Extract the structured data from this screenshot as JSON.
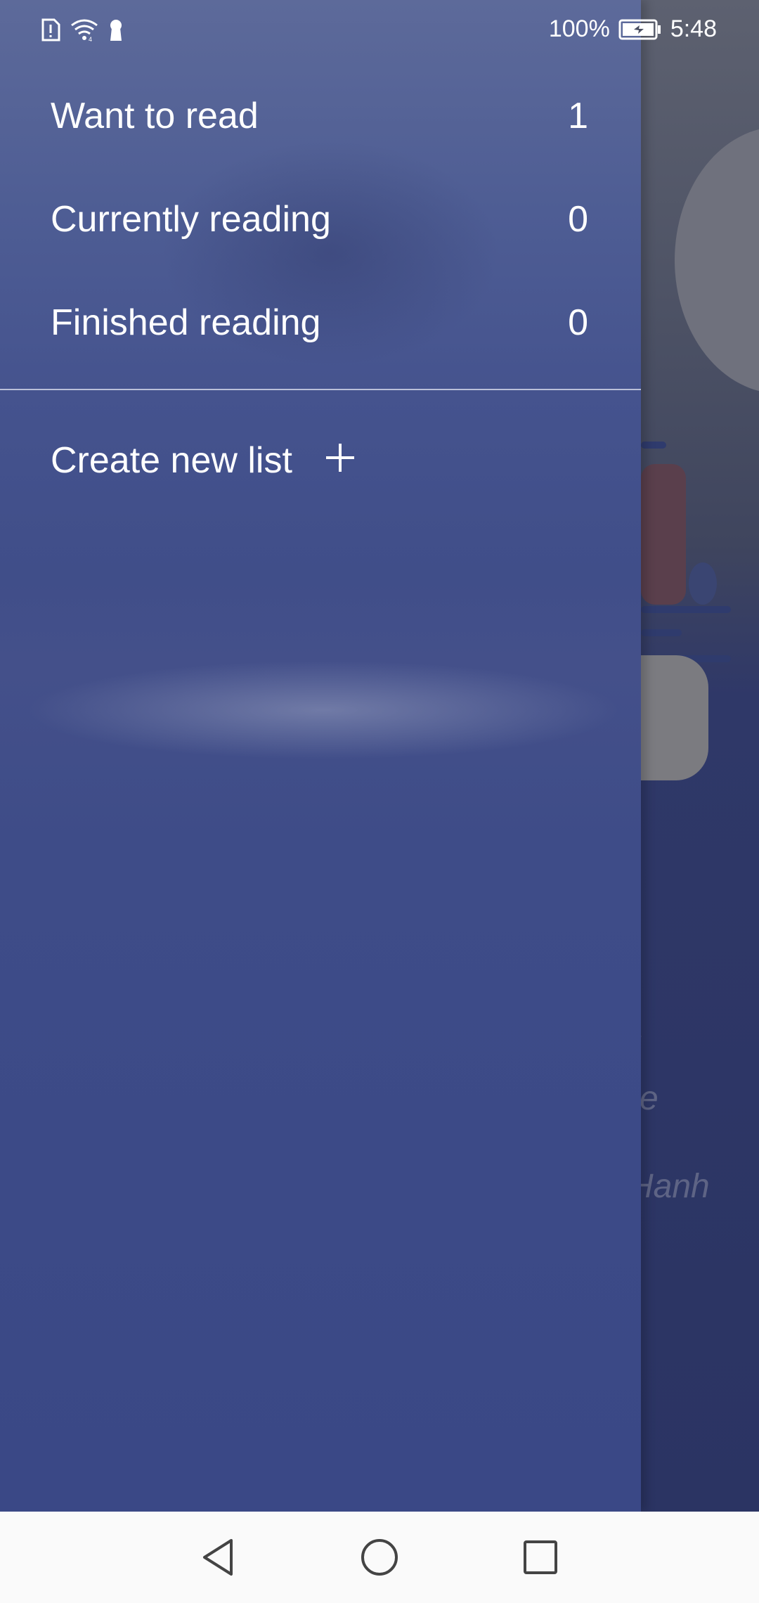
{
  "status_bar": {
    "battery_percent": "100%",
    "time": "5:48",
    "icons": [
      "sim-alert-icon",
      "wifi-icon",
      "keyhole-icon",
      "battery-charging-icon"
    ]
  },
  "drawer": {
    "lists": [
      {
        "label": "Want to read",
        "count": "1"
      },
      {
        "label": "Currently reading",
        "count": "0"
      },
      {
        "label": "Finished reading",
        "count": "0"
      }
    ],
    "create_list": {
      "label": "Create new list",
      "icon": "plus-icon"
    }
  },
  "background": {
    "partial_text": [
      "f",
      "e",
      "Hanh"
    ]
  },
  "nav_bar": {
    "icons": [
      "back-icon",
      "home-icon",
      "recents-icon"
    ]
  },
  "colors": {
    "drawer_top": "#5d6a9a",
    "drawer_bottom": "#3a4886",
    "nav_bar": "#fafafa",
    "text": "#ffffff"
  }
}
